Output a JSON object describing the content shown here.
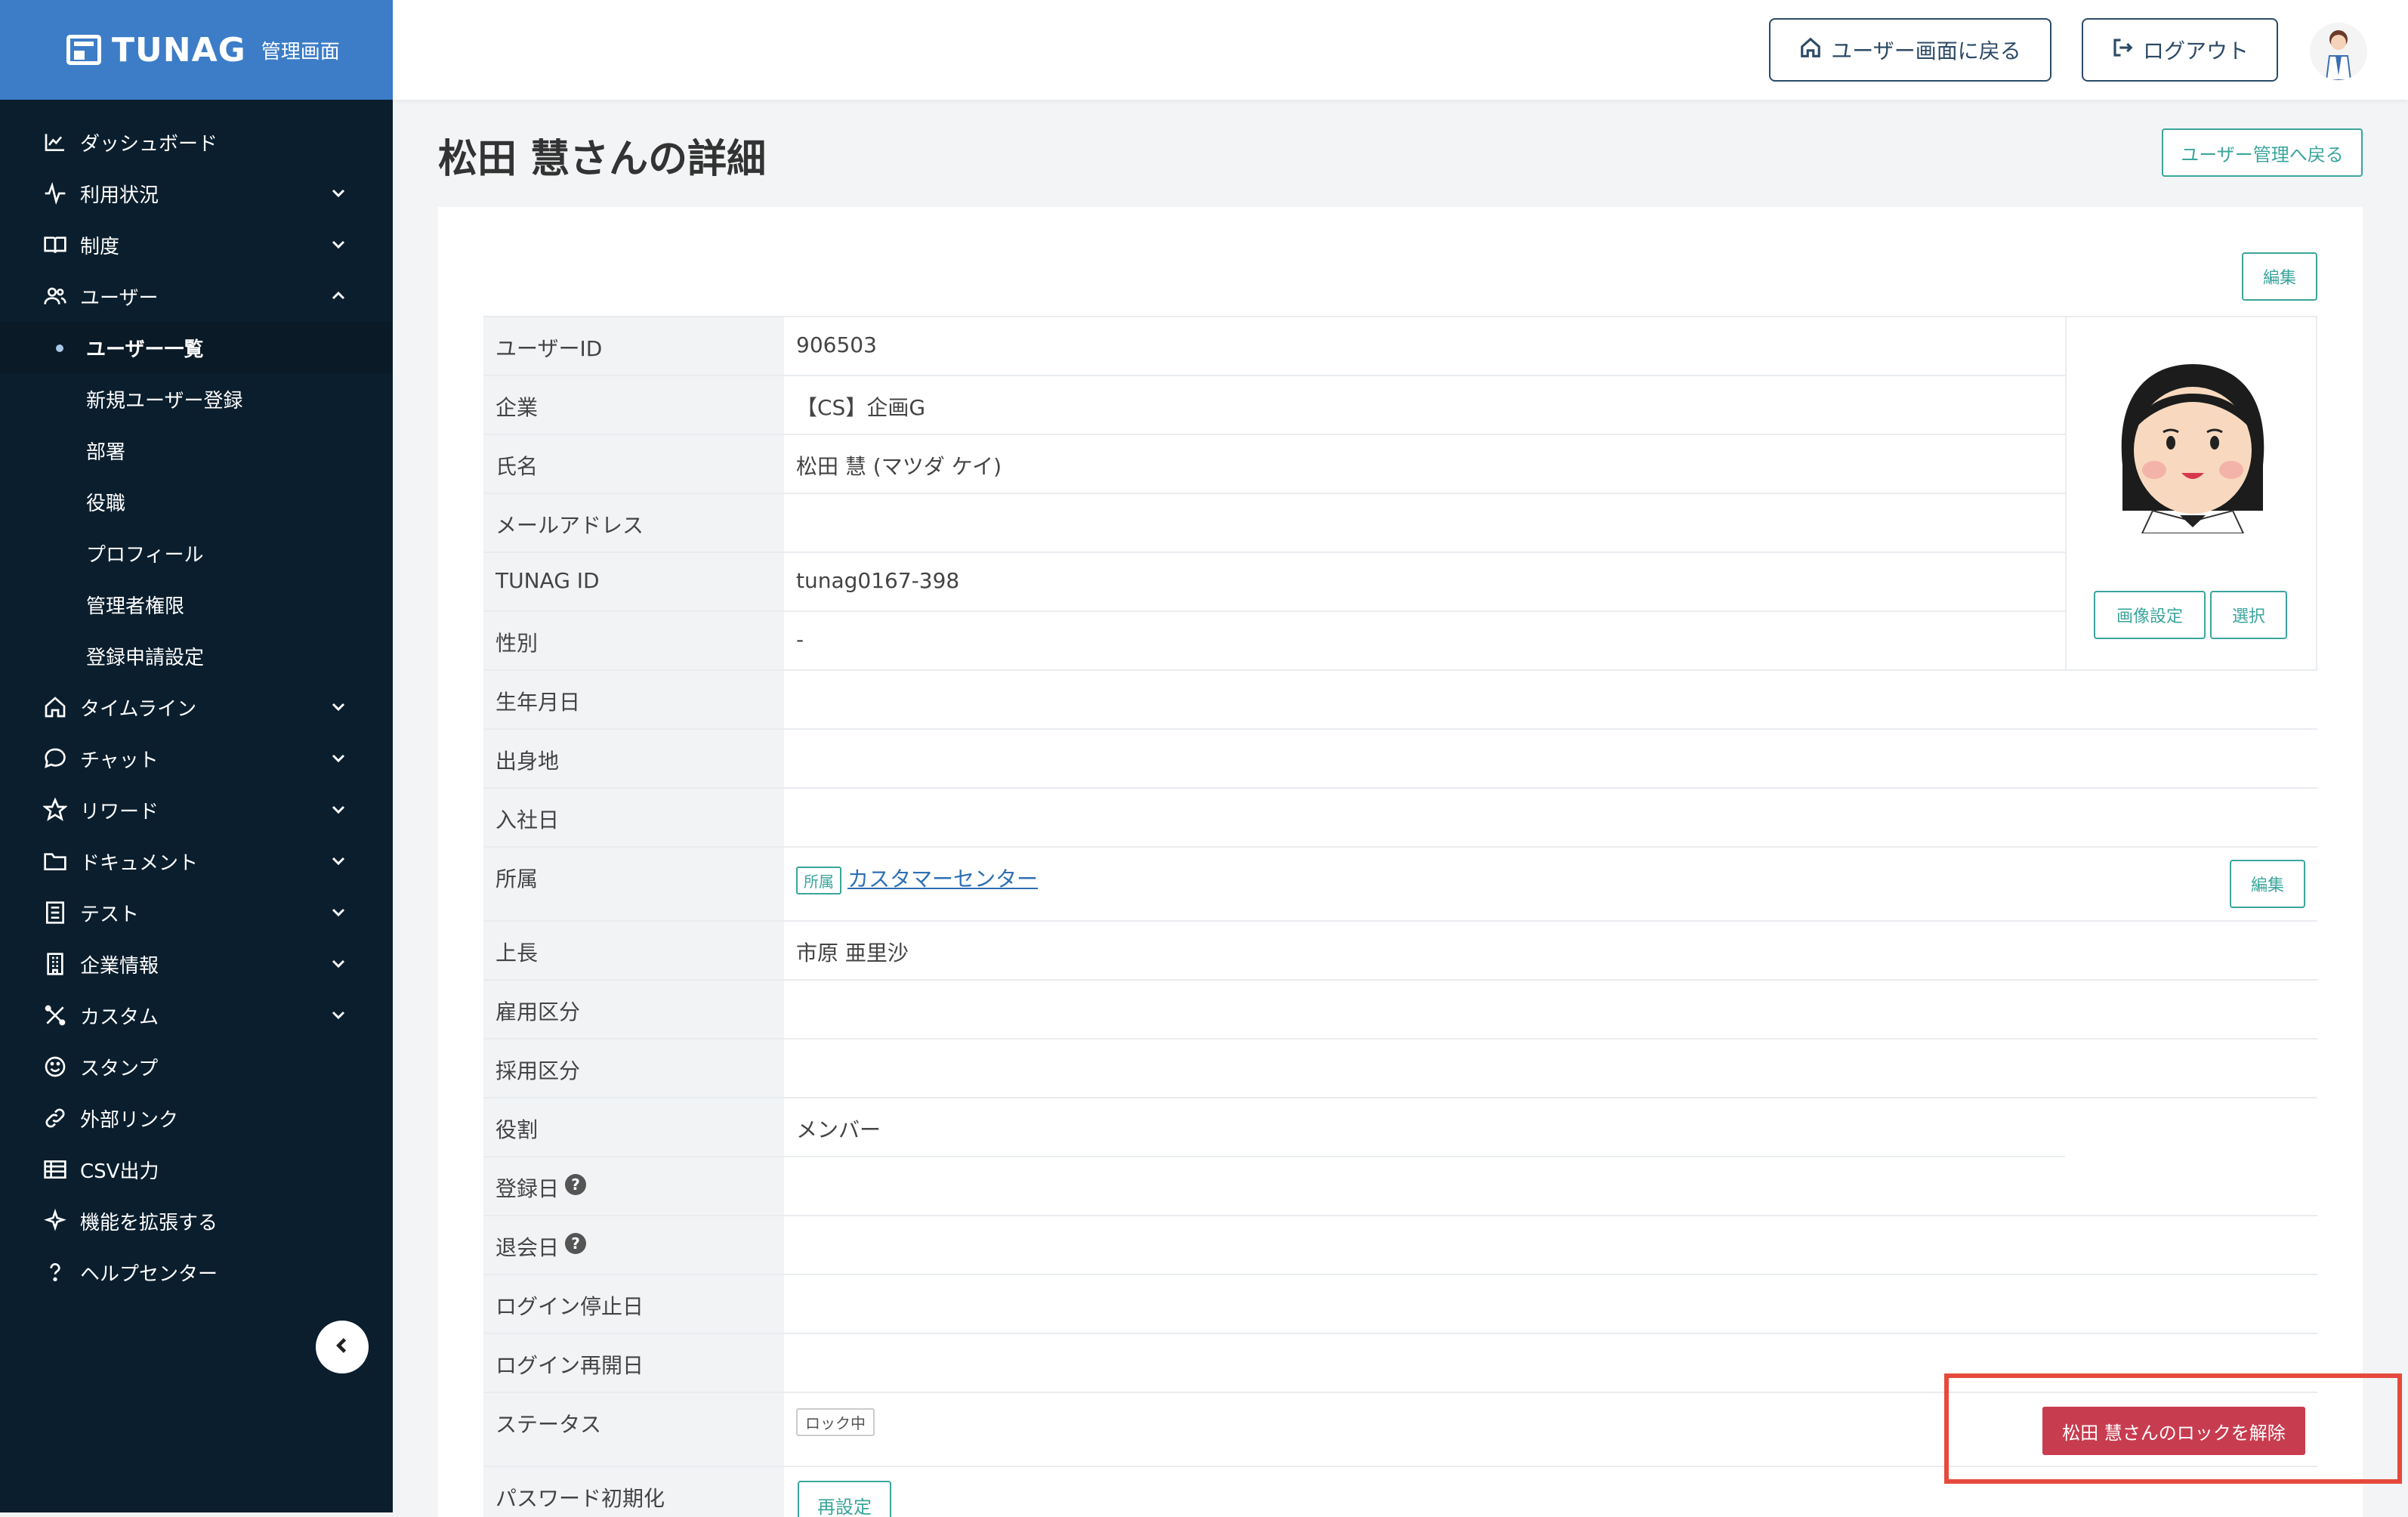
{
  "brand": {
    "name": "TUNAG",
    "subtitle": "管理画面"
  },
  "sidebar": {
    "items": [
      {
        "label": "ダッシュボード",
        "icon": "chart-line-icon",
        "expand": ""
      },
      {
        "label": "利用状況",
        "icon": "activity-icon",
        "expand": "down"
      },
      {
        "label": "制度",
        "icon": "book-icon",
        "expand": "down"
      },
      {
        "label": "ユーザー",
        "icon": "users-icon",
        "expand": "up"
      },
      {
        "label": "タイムライン",
        "icon": "home-icon",
        "expand": "down"
      },
      {
        "label": "チャット",
        "icon": "chat-icon",
        "expand": "down"
      },
      {
        "label": "リワード",
        "icon": "star-icon",
        "expand": "down"
      },
      {
        "label": "ドキュメント",
        "icon": "folder-icon",
        "expand": "down"
      },
      {
        "label": "テスト",
        "icon": "checklist-icon",
        "expand": "down"
      },
      {
        "label": "企業情報",
        "icon": "building-icon",
        "expand": "down"
      },
      {
        "label": "カスタム",
        "icon": "tools-icon",
        "expand": "down"
      },
      {
        "label": "スタンプ",
        "icon": "smile-icon",
        "expand": ""
      },
      {
        "label": "外部リンク",
        "icon": "link-icon",
        "expand": ""
      },
      {
        "label": "CSV出力",
        "icon": "table-icon",
        "expand": ""
      },
      {
        "label": "機能を拡張する",
        "icon": "sparkle-icon",
        "expand": ""
      },
      {
        "label": "ヘルプセンター",
        "icon": "question-icon",
        "expand": ""
      }
    ],
    "user_subitems": [
      "ユーザー一覧",
      "新規ユーザー登録",
      "部署",
      "役職",
      "プロフィール",
      "管理者権限",
      "登録申請設定"
    ],
    "active_subitem": "ユーザー一覧"
  },
  "header": {
    "user_screen_button": "ユーザー画面に戻る",
    "logout_button": "ログアウト"
  },
  "page": {
    "title": "松田 慧さんの詳細",
    "back_button": "ユーザー管理へ戻る",
    "edit_label": "編集",
    "image_setting_button": "画像設定",
    "select_button": "選択",
    "affiliation_tag": "所属",
    "affiliation_link": "カスタマーセンター",
    "status_tag": "ロック中",
    "unlock_button": "松田 慧さんのロックを解除",
    "reset_button": "再設定",
    "fields": [
      {
        "label": "ユーザーID",
        "value": "906503"
      },
      {
        "label": "企業",
        "value": "【CS】企画G"
      },
      {
        "label": "氏名",
        "value": "松田 慧 (マツダ ケイ)"
      },
      {
        "label": "メールアドレス",
        "value": ""
      },
      {
        "label": "TUNAG ID",
        "value": "tunag0167-398"
      },
      {
        "label": "性別",
        "value": "-"
      },
      {
        "label": "生年月日",
        "value": ""
      },
      {
        "label": "出身地",
        "value": ""
      },
      {
        "label": "入社日",
        "value": ""
      },
      {
        "label": "所属",
        "value": ""
      },
      {
        "label": "上長",
        "value": "市原 亜里沙"
      },
      {
        "label": "雇用区分",
        "value": ""
      },
      {
        "label": "採用区分",
        "value": ""
      },
      {
        "label": "役割",
        "value": "メンバー"
      },
      {
        "label": "登録日",
        "value": ""
      },
      {
        "label": "退会日",
        "value": ""
      },
      {
        "label": "ログイン停止日",
        "value": ""
      },
      {
        "label": "ログイン再開日",
        "value": ""
      },
      {
        "label": "ステータス",
        "value": ""
      },
      {
        "label": "パスワード初期化",
        "value": ""
      }
    ]
  },
  "colors": {
    "sidebar": "#0b1e2d",
    "brand": "#3d7dc8",
    "accent": "#3aa59c",
    "danger": "#c83c4f",
    "highlight": "#e64a3c"
  }
}
